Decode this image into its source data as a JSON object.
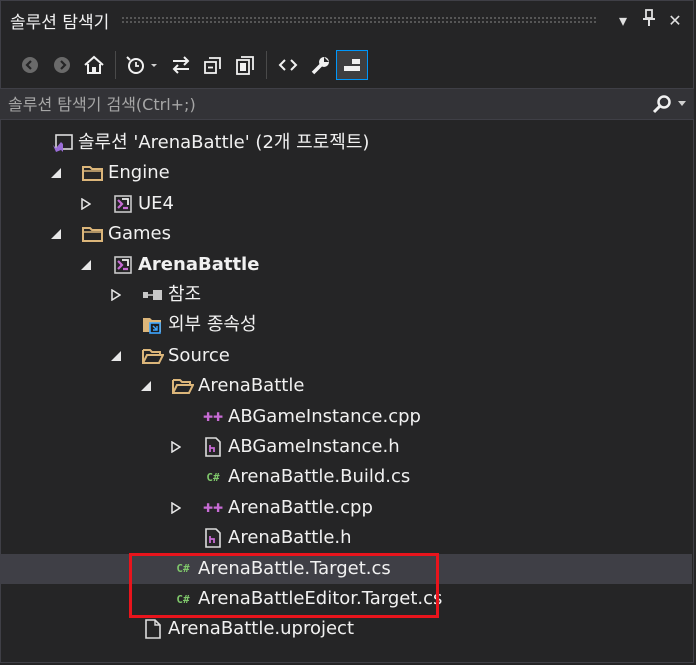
{
  "window": {
    "title": "솔루션 탐색기",
    "dropdown_glyph": "▾",
    "pin_glyph": "⊥",
    "close_glyph": "✕"
  },
  "toolbar": {
    "buttons": [
      "back-icon",
      "forward-icon",
      "home-icon",
      "history-icon",
      "sync-icon",
      "collapse-all-icon",
      "show-all-files-icon",
      "view-code-icon",
      "properties-icon",
      "preview-icon"
    ]
  },
  "search": {
    "placeholder": "솔루션 탐색기 검색(Ctrl+;)"
  },
  "tree": [
    {
      "label": "솔루션 'ArenaBattle' (2개 프로젝트)",
      "icon": "solution-icon",
      "arrow": ""
    },
    {
      "label": "Engine",
      "icon": "folder-icon",
      "arrow": "expanded"
    },
    {
      "label": "UE4",
      "icon": "project-icon",
      "arrow": "collapsed"
    },
    {
      "label": "Games",
      "icon": "folder-icon",
      "arrow": "expanded"
    },
    {
      "label": "ArenaBattle",
      "icon": "project-icon",
      "arrow": "expanded",
      "bold": true
    },
    {
      "label": "참조",
      "icon": "references-icon",
      "arrow": "collapsed"
    },
    {
      "label": "외부 종속성",
      "icon": "external-deps-icon",
      "arrow": ""
    },
    {
      "label": "Source",
      "icon": "open-folder-icon",
      "arrow": "expanded"
    },
    {
      "label": "ArenaBattle",
      "icon": "open-folder-icon",
      "arrow": "expanded"
    },
    {
      "label": "ABGameInstance.cpp",
      "icon": "cpp-file-icon",
      "arrow": ""
    },
    {
      "label": "ABGameInstance.h",
      "icon": "header-file-icon",
      "arrow": "collapsed"
    },
    {
      "label": "ArenaBattle.Build.cs",
      "icon": "csharp-file-icon",
      "arrow": ""
    },
    {
      "label": "ArenaBattle.cpp",
      "icon": "cpp-file-icon",
      "arrow": "collapsed"
    },
    {
      "label": "ArenaBattle.h",
      "icon": "header-file-icon",
      "arrow": ""
    },
    {
      "label": "ArenaBattle.Target.cs",
      "icon": "csharp-file-icon",
      "arrow": "",
      "selected": true
    },
    {
      "label": "ArenaBattleEditor.Target.cs",
      "icon": "csharp-file-icon",
      "arrow": ""
    },
    {
      "label": "ArenaBattle.uproject",
      "icon": "file-icon",
      "arrow": ""
    }
  ],
  "colors": {
    "background": "#252526",
    "selection": "#3f3f46",
    "highlight_box": "#e8141c",
    "folder": "#dcb67a",
    "csharp": "#7fc76b",
    "cpp": "#c76bd4"
  }
}
